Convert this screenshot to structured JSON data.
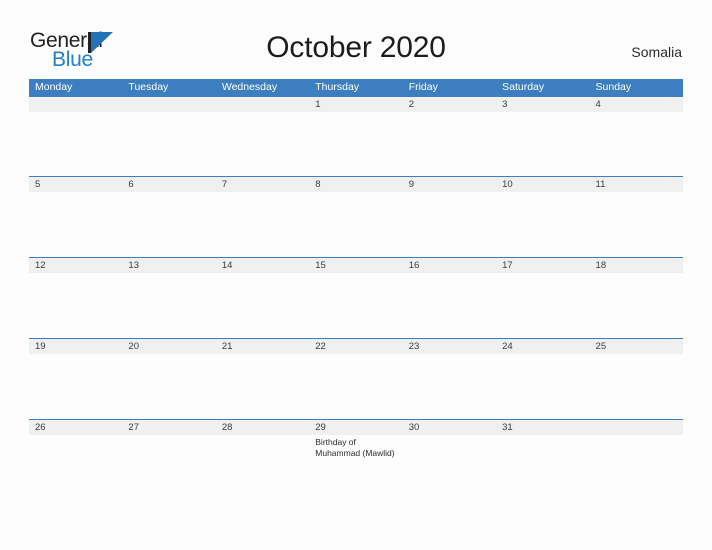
{
  "brand": {
    "name_top": "General",
    "name_bottom": "Blue"
  },
  "header": {
    "title": "October 2020",
    "region": "Somalia"
  },
  "colors": {
    "header_blue": "#3c7ebf",
    "logo_blue": "#2480c8",
    "date_band": "#f0f0f0",
    "page_background": "#fdfdfd"
  },
  "calendar": {
    "weekdays": [
      "Monday",
      "Tuesday",
      "Wednesday",
      "Thursday",
      "Friday",
      "Saturday",
      "Sunday"
    ],
    "weeks": [
      {
        "days": [
          {
            "date": "",
            "event": ""
          },
          {
            "date": "",
            "event": ""
          },
          {
            "date": "",
            "event": ""
          },
          {
            "date": "1",
            "event": ""
          },
          {
            "date": "2",
            "event": ""
          },
          {
            "date": "3",
            "event": ""
          },
          {
            "date": "4",
            "event": ""
          }
        ]
      },
      {
        "days": [
          {
            "date": "5",
            "event": ""
          },
          {
            "date": "6",
            "event": ""
          },
          {
            "date": "7",
            "event": ""
          },
          {
            "date": "8",
            "event": ""
          },
          {
            "date": "9",
            "event": ""
          },
          {
            "date": "10",
            "event": ""
          },
          {
            "date": "11",
            "event": ""
          }
        ]
      },
      {
        "days": [
          {
            "date": "12",
            "event": ""
          },
          {
            "date": "13",
            "event": ""
          },
          {
            "date": "14",
            "event": ""
          },
          {
            "date": "15",
            "event": ""
          },
          {
            "date": "16",
            "event": ""
          },
          {
            "date": "17",
            "event": ""
          },
          {
            "date": "18",
            "event": ""
          }
        ]
      },
      {
        "days": [
          {
            "date": "19",
            "event": ""
          },
          {
            "date": "20",
            "event": ""
          },
          {
            "date": "21",
            "event": ""
          },
          {
            "date": "22",
            "event": ""
          },
          {
            "date": "23",
            "event": ""
          },
          {
            "date": "24",
            "event": ""
          },
          {
            "date": "25",
            "event": ""
          }
        ]
      },
      {
        "days": [
          {
            "date": "26",
            "event": ""
          },
          {
            "date": "27",
            "event": ""
          },
          {
            "date": "28",
            "event": ""
          },
          {
            "date": "29",
            "event": "Birthday of Muhammad (Mawlid)"
          },
          {
            "date": "30",
            "event": ""
          },
          {
            "date": "31",
            "event": ""
          },
          {
            "date": "",
            "event": ""
          }
        ]
      }
    ]
  }
}
